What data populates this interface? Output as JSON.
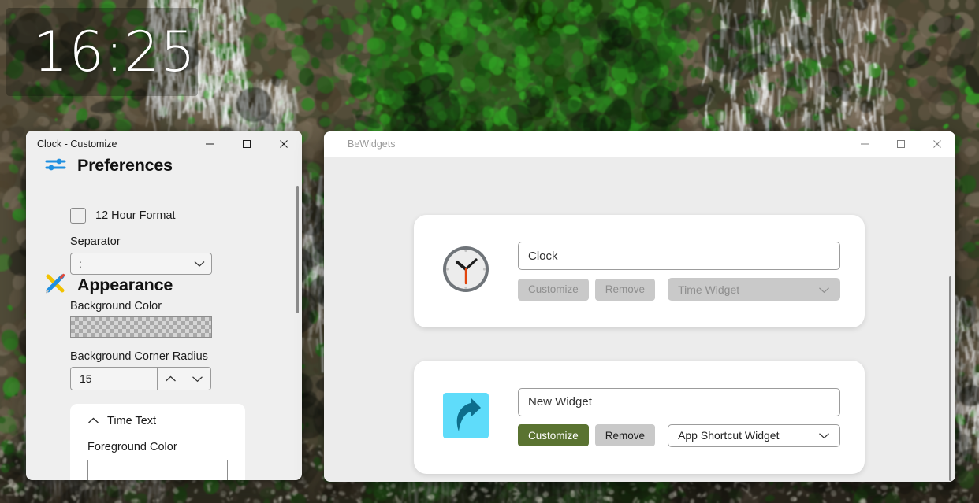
{
  "desktop": {
    "clock_widget": {
      "time": "16:25",
      "name": "clock-widget"
    },
    "wallpaper_description": "waterfall-jungle-wallpaper"
  },
  "clock_window": {
    "title": "Clock - Customize",
    "controls": {
      "minimize": "minimize-icon",
      "maximize": "maximize-icon",
      "close": "close-icon"
    },
    "preferences": {
      "heading": "Preferences",
      "icon": "sliders-icon",
      "checkbox_label": "12 Hour Format",
      "checkbox_checked": false,
      "separator_label": "Separator",
      "separator_value": ":"
    },
    "appearance": {
      "heading": "Appearance",
      "icon": "pencil-ruler-icon",
      "background_color_label": "Background Color",
      "background_color_value": "transparent",
      "corner_radius_label": "Background Corner Radius",
      "corner_radius_value": "15",
      "time_text": {
        "heading": "Time Text",
        "foreground_color_label": "Foreground Color",
        "foreground_color_value": "#ffffff"
      }
    }
  },
  "bewidgets_window": {
    "title": "BeWidgets",
    "controls": {
      "minimize": "minimize-icon",
      "maximize": "maximize-icon",
      "close": "close-icon"
    },
    "widgets": [
      {
        "icon": "analog-clock-icon",
        "name_value": "Clock",
        "customize_label": "Customize",
        "remove_label": "Remove",
        "type_value": "Time Widget",
        "enabled": false
      },
      {
        "icon": "app-shortcut-icon",
        "name_value": "New Widget",
        "customize_label": "Customize",
        "remove_label": "Remove",
        "type_value": "App Shortcut Widget",
        "enabled": true
      }
    ]
  },
  "colors": {
    "accent_green": "#5a7331",
    "neutral_button": "#c9c9c9",
    "window_bg": "#efefef",
    "card_bg": "#ffffff",
    "icon_blue": "#1e8fe0",
    "shortcut_cyan": "#5fdcfa",
    "shortcut_arrow": "#0d6e8c"
  }
}
